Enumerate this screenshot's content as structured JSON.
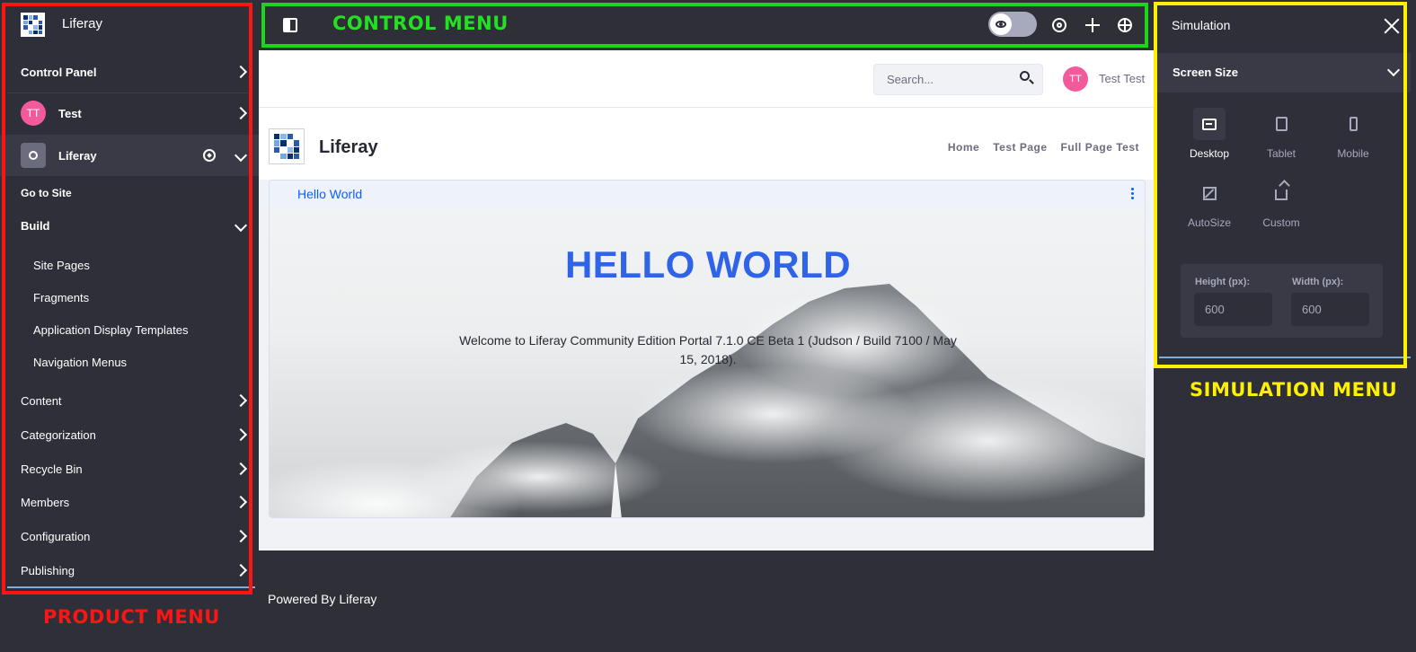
{
  "product_menu": {
    "title": "Liferay",
    "control_panel": "Control Panel",
    "user": {
      "initials": "TT",
      "name": "Test"
    },
    "site": {
      "name": "Liferay"
    },
    "go_to_site": "Go to Site",
    "build": {
      "label": "Build",
      "items": [
        "Site Pages",
        "Fragments",
        "Application Display Templates",
        "Navigation Menus"
      ]
    },
    "sections": [
      "Content",
      "Categorization",
      "Recycle Bin",
      "Members",
      "Configuration",
      "Publishing"
    ]
  },
  "annotations": {
    "product_menu": "PRODUCT MENU",
    "control_menu": "CONTROL MENU",
    "simulation_menu": "SIMULATION MENU"
  },
  "page": {
    "search_placeholder": "Search...",
    "user_initials": "TT",
    "user_name": "Test Test",
    "site_name": "Liferay",
    "nav": [
      "Home",
      "Test Page",
      "Full Page Test"
    ],
    "portlet_title": "Hello World",
    "hero_title": "HELLO WORLD",
    "hero_text": "Welcome to Liferay Community Edition Portal 7.1.0 CE Beta 1 (Judson / Build 7100 / May 15, 2018).",
    "footer": "Powered By Liferay"
  },
  "simulation": {
    "title": "Simulation",
    "screen_size": "Screen Size",
    "devices": [
      "Desktop",
      "Tablet",
      "Mobile",
      "AutoSize",
      "Custom"
    ],
    "selected_device": "Desktop",
    "height_label": "Height (px):",
    "width_label": "Width (px):",
    "height_value": "600",
    "width_value": "600"
  },
  "colors": {
    "menu_bg": "#2e2f38",
    "accent_blue": "#0b5fff",
    "hero_blue": "#2f63e8",
    "avatar_pink": "#f35a9c",
    "annotation_red": "#ff1414",
    "annotation_green": "#1cd61c",
    "annotation_yellow": "#ffef00"
  }
}
